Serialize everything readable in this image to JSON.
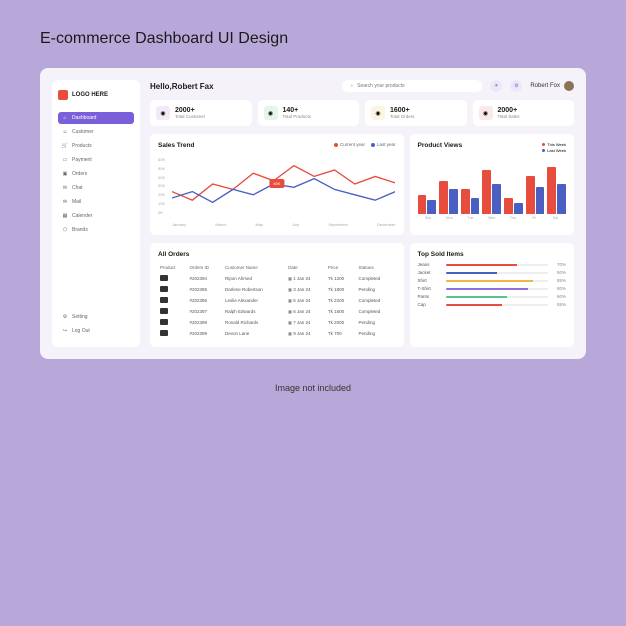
{
  "page_title": "E-commerce Dashboard UI Design",
  "footer_note": "Image not included",
  "logo_text": "LOGO HERE",
  "sidebar": {
    "items": [
      {
        "icon": "home-icon",
        "label": "Dashboard",
        "active": true
      },
      {
        "icon": "user-icon",
        "label": "Customer"
      },
      {
        "icon": "cart-icon",
        "label": "Products"
      },
      {
        "icon": "card-icon",
        "label": "Payment"
      },
      {
        "icon": "box-icon",
        "label": "Orders"
      },
      {
        "icon": "chat-icon",
        "label": "Chat"
      },
      {
        "icon": "mail-icon",
        "label": "Mail"
      },
      {
        "icon": "calendar-icon",
        "label": "Calender"
      },
      {
        "icon": "tag-icon",
        "label": "Brands"
      }
    ],
    "bottom": [
      {
        "icon": "settings-icon",
        "label": "Setting"
      },
      {
        "icon": "logout-icon",
        "label": "Log Out"
      }
    ]
  },
  "topbar": {
    "greeting": "Hello,Robert Fax",
    "search_placeholder": "Search your products",
    "user_name": "Robert Fox"
  },
  "stats": [
    {
      "value": "2000+",
      "label": "Total Customer",
      "color": "#f3e9f7"
    },
    {
      "value": "140+",
      "label": "Total Products",
      "color": "#e6f5ec"
    },
    {
      "value": "1600+",
      "label": "Total Orders",
      "color": "#fcf5e3"
    },
    {
      "value": "2000+",
      "label": "Total Sales",
      "color": "#fbe9e9"
    }
  ],
  "chart_data": [
    {
      "type": "line",
      "title": "Sales Trend",
      "legend": [
        {
          "name": "Current year",
          "color": "#e74c3c"
        },
        {
          "name": "Last year",
          "color": "#4a5fc1"
        }
      ],
      "tooltip": "45K",
      "ylabel": "",
      "ylim": [
        0,
        60
      ],
      "y_ticks": [
        "60K",
        "50K",
        "40K",
        "30K",
        "20K",
        "10K",
        "0K"
      ],
      "categories": [
        "January",
        "March",
        "May",
        "July",
        "September",
        "December"
      ],
      "series": [
        {
          "name": "Current year",
          "values": [
            28,
            20,
            35,
            30,
            45,
            38,
            52,
            42,
            48,
            35,
            42,
            36
          ]
        },
        {
          "name": "Last year",
          "values": [
            22,
            28,
            18,
            30,
            25,
            35,
            32,
            40,
            30,
            25,
            20,
            28
          ]
        }
      ]
    },
    {
      "type": "bar",
      "title": "Product Views",
      "legend": [
        {
          "name": "This Week",
          "color": "#e74c3c"
        },
        {
          "name": "Last Week",
          "color": "#4a5fc1"
        }
      ],
      "categories": [
        "Sun",
        "Mon",
        "Tue",
        "Wed",
        "Thu",
        "Fri",
        "Sat"
      ],
      "series": [
        {
          "name": "This Week",
          "values": [
            35,
            60,
            45,
            80,
            30,
            70,
            85
          ]
        },
        {
          "name": "Last Week",
          "values": [
            25,
            45,
            30,
            55,
            20,
            50,
            55
          ]
        }
      ]
    }
  ],
  "orders": {
    "title": "All Orders",
    "columns": [
      "Product",
      "Orders ID",
      "Customer Name",
      "Date",
      "Price",
      "Statues"
    ],
    "rows": [
      {
        "id": "#202394",
        "name": "Ripon Ahmed",
        "date": "1 Jan 24",
        "price": "Tk 1200",
        "status": "Completed"
      },
      {
        "id": "#202395",
        "name": "Darlene Robertson",
        "date": "3 Jan 24",
        "price": "Tk 1800",
        "status": "Pending"
      },
      {
        "id": "#202396",
        "name": "Leslie Alexander",
        "date": "5 Jan 24",
        "price": "Tk 2200",
        "status": "Completed"
      },
      {
        "id": "#202397",
        "name": "Ralph Edwards",
        "date": "6 Jan 24",
        "price": "Tk 1600",
        "status": "Completed"
      },
      {
        "id": "#202398",
        "name": "Ronald Richards",
        "date": "7 Jan 24",
        "price": "Tk 2000",
        "status": "Pending"
      },
      {
        "id": "#202399",
        "name": "Devon Lane",
        "date": "9 Jan 24",
        "price": "Tk 700",
        "status": "Pending"
      }
    ]
  },
  "top_items": {
    "title": "Top Sold Items",
    "items": [
      {
        "name": "Jeans",
        "pct": 70,
        "color": "#e74c3c"
      },
      {
        "name": "Jacket",
        "pct": 50,
        "color": "#4a5fc1"
      },
      {
        "name": "Shirt",
        "pct": 85,
        "color": "#f5b342"
      },
      {
        "name": "T-Shirt",
        "pct": 80,
        "color": "#8c6fd9"
      },
      {
        "name": "Pants",
        "pct": 60,
        "color": "#5cc28a"
      },
      {
        "name": "Cap",
        "pct": 55,
        "color": "#e74c3c"
      }
    ]
  }
}
